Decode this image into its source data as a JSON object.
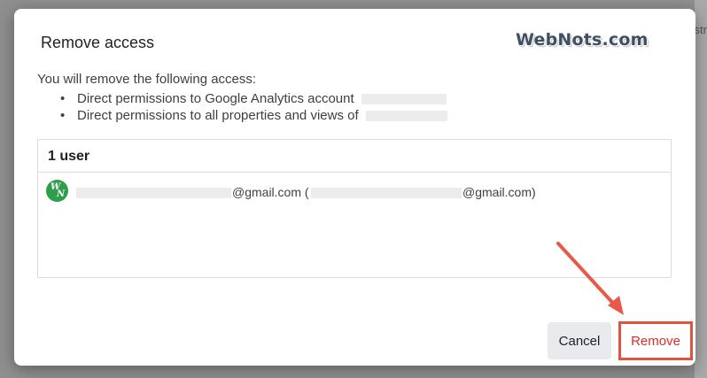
{
  "backdrop": {
    "fragment_text": "str"
  },
  "dialog": {
    "title": "Remove access",
    "watermark": "WebNots.com",
    "intro": "You will remove the following access:",
    "bullets": [
      {
        "text": "Direct permissions to Google Analytics account"
      },
      {
        "text": "Direct permissions to all properties and views of"
      }
    ],
    "users": {
      "header": "1 user",
      "rows": [
        {
          "avatar_letters": [
            "W",
            "N"
          ],
          "email_suffix": "@gmail.com (",
          "secondary_email_suffix": "@gmail.com)"
        }
      ]
    },
    "actions": {
      "cancel_label": "Cancel",
      "remove_label": "Remove"
    }
  },
  "colors": {
    "remove_text": "#d93025",
    "highlight_border": "#e0533f",
    "annotation_arrow": "#e9594a",
    "avatar_bg": "#2e9e4a",
    "cancel_bg": "#e8eaed"
  },
  "icons": {
    "avatar": "webnots-avatar-icon",
    "annotation": "arrow-annotation-icon"
  }
}
